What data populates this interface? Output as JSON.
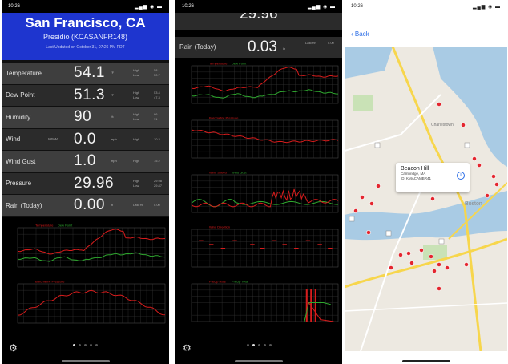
{
  "colors": {
    "header_blue": "#1e35cf",
    "line_red": "#d81c1c",
    "line_green": "#2fa82f",
    "map_water": "#a9cbe4",
    "map_park": "#c9e2b6",
    "map_road": "#f7d64c",
    "pin_red": "#e4262f"
  },
  "phone1": {
    "status": {
      "time": "10:26",
      "signal": "▂▄▆ ◉ ▬"
    },
    "header": {
      "city": "San Francisco, CA",
      "station": "Presidio (KCASANFR148)",
      "updated": "Last Updated on October 31, 07:26 PM PDT"
    },
    "rows": [
      {
        "label": "Temperature",
        "value": "54.1",
        "unit": "°F",
        "sub": "",
        "hl1": "High",
        "hv1": "58.1",
        "hl2": "Low",
        "hv2": "50.7"
      },
      {
        "label": "Dew Point",
        "value": "51.3",
        "unit": "°F",
        "sub": "",
        "hl1": "High",
        "hv1": "53.4",
        "hl2": "Low",
        "hv2": "47.3"
      },
      {
        "label": "Humidity",
        "value": "90",
        "unit": "%",
        "sub": "",
        "hl1": "High",
        "hv1": "96",
        "hl2": "Low",
        "hv2": "71"
      },
      {
        "label": "Wind",
        "value": "0.0",
        "unit": "mph",
        "sub": "WNW",
        "hl1": "High",
        "hv1": "10.3",
        "hl2": "",
        "hv2": ""
      },
      {
        "label": "Wind Gust",
        "value": "1.0",
        "unit": "mph",
        "sub": "",
        "hl1": "High",
        "hv1": "15.2",
        "hl2": "",
        "hv2": ""
      },
      {
        "label": "Pressure",
        "value": "29.96",
        "unit": "in",
        "sub": "",
        "hl1": "High",
        "hv1": "29.98",
        "hl2": "Low",
        "hv2": "29.87"
      },
      {
        "label": "Rain (Today)",
        "value": "0.00",
        "unit": "in",
        "sub": "",
        "hl1": "Last Hr",
        "hv1": "0.00",
        "hl2": "",
        "hv2": ""
      }
    ],
    "charts": [
      {
        "legend": [
          "Temperature",
          "Dew Point"
        ]
      },
      {
        "legend": [
          "Barometric Pressure"
        ]
      }
    ]
  },
  "phone2": {
    "status": {
      "time": "10:26",
      "signal": "▂▄▆ ◉ ▬"
    },
    "top_value": "29.96",
    "rain_label": "Rain (Today)",
    "rain_value": "0.03",
    "rain_unit": "in",
    "rain_hl": "Last Hr",
    "rain_hv": "0.00",
    "charts": [
      {
        "legend": [
          "Temperature",
          "Dew Point"
        ]
      },
      {
        "legend": [
          "Barometric Pressure"
        ]
      },
      {
        "legend": [
          "Wind Speed",
          "Wind Gust"
        ]
      },
      {
        "legend": [
          "Wind Direction"
        ]
      },
      {
        "legend": [
          "Precip Rate",
          "Precip Total"
        ]
      }
    ]
  },
  "phone3": {
    "status": {
      "time": "10:26",
      "signal": "▂▄▆ ◉ ▬"
    },
    "back": "Back",
    "callout": {
      "name": "Beacon Hill",
      "addr1": "Cambridge, MA",
      "addr2": "ID: KMACAMBR41"
    },
    "city": "Boston",
    "neighborhood": "Charlestown"
  }
}
